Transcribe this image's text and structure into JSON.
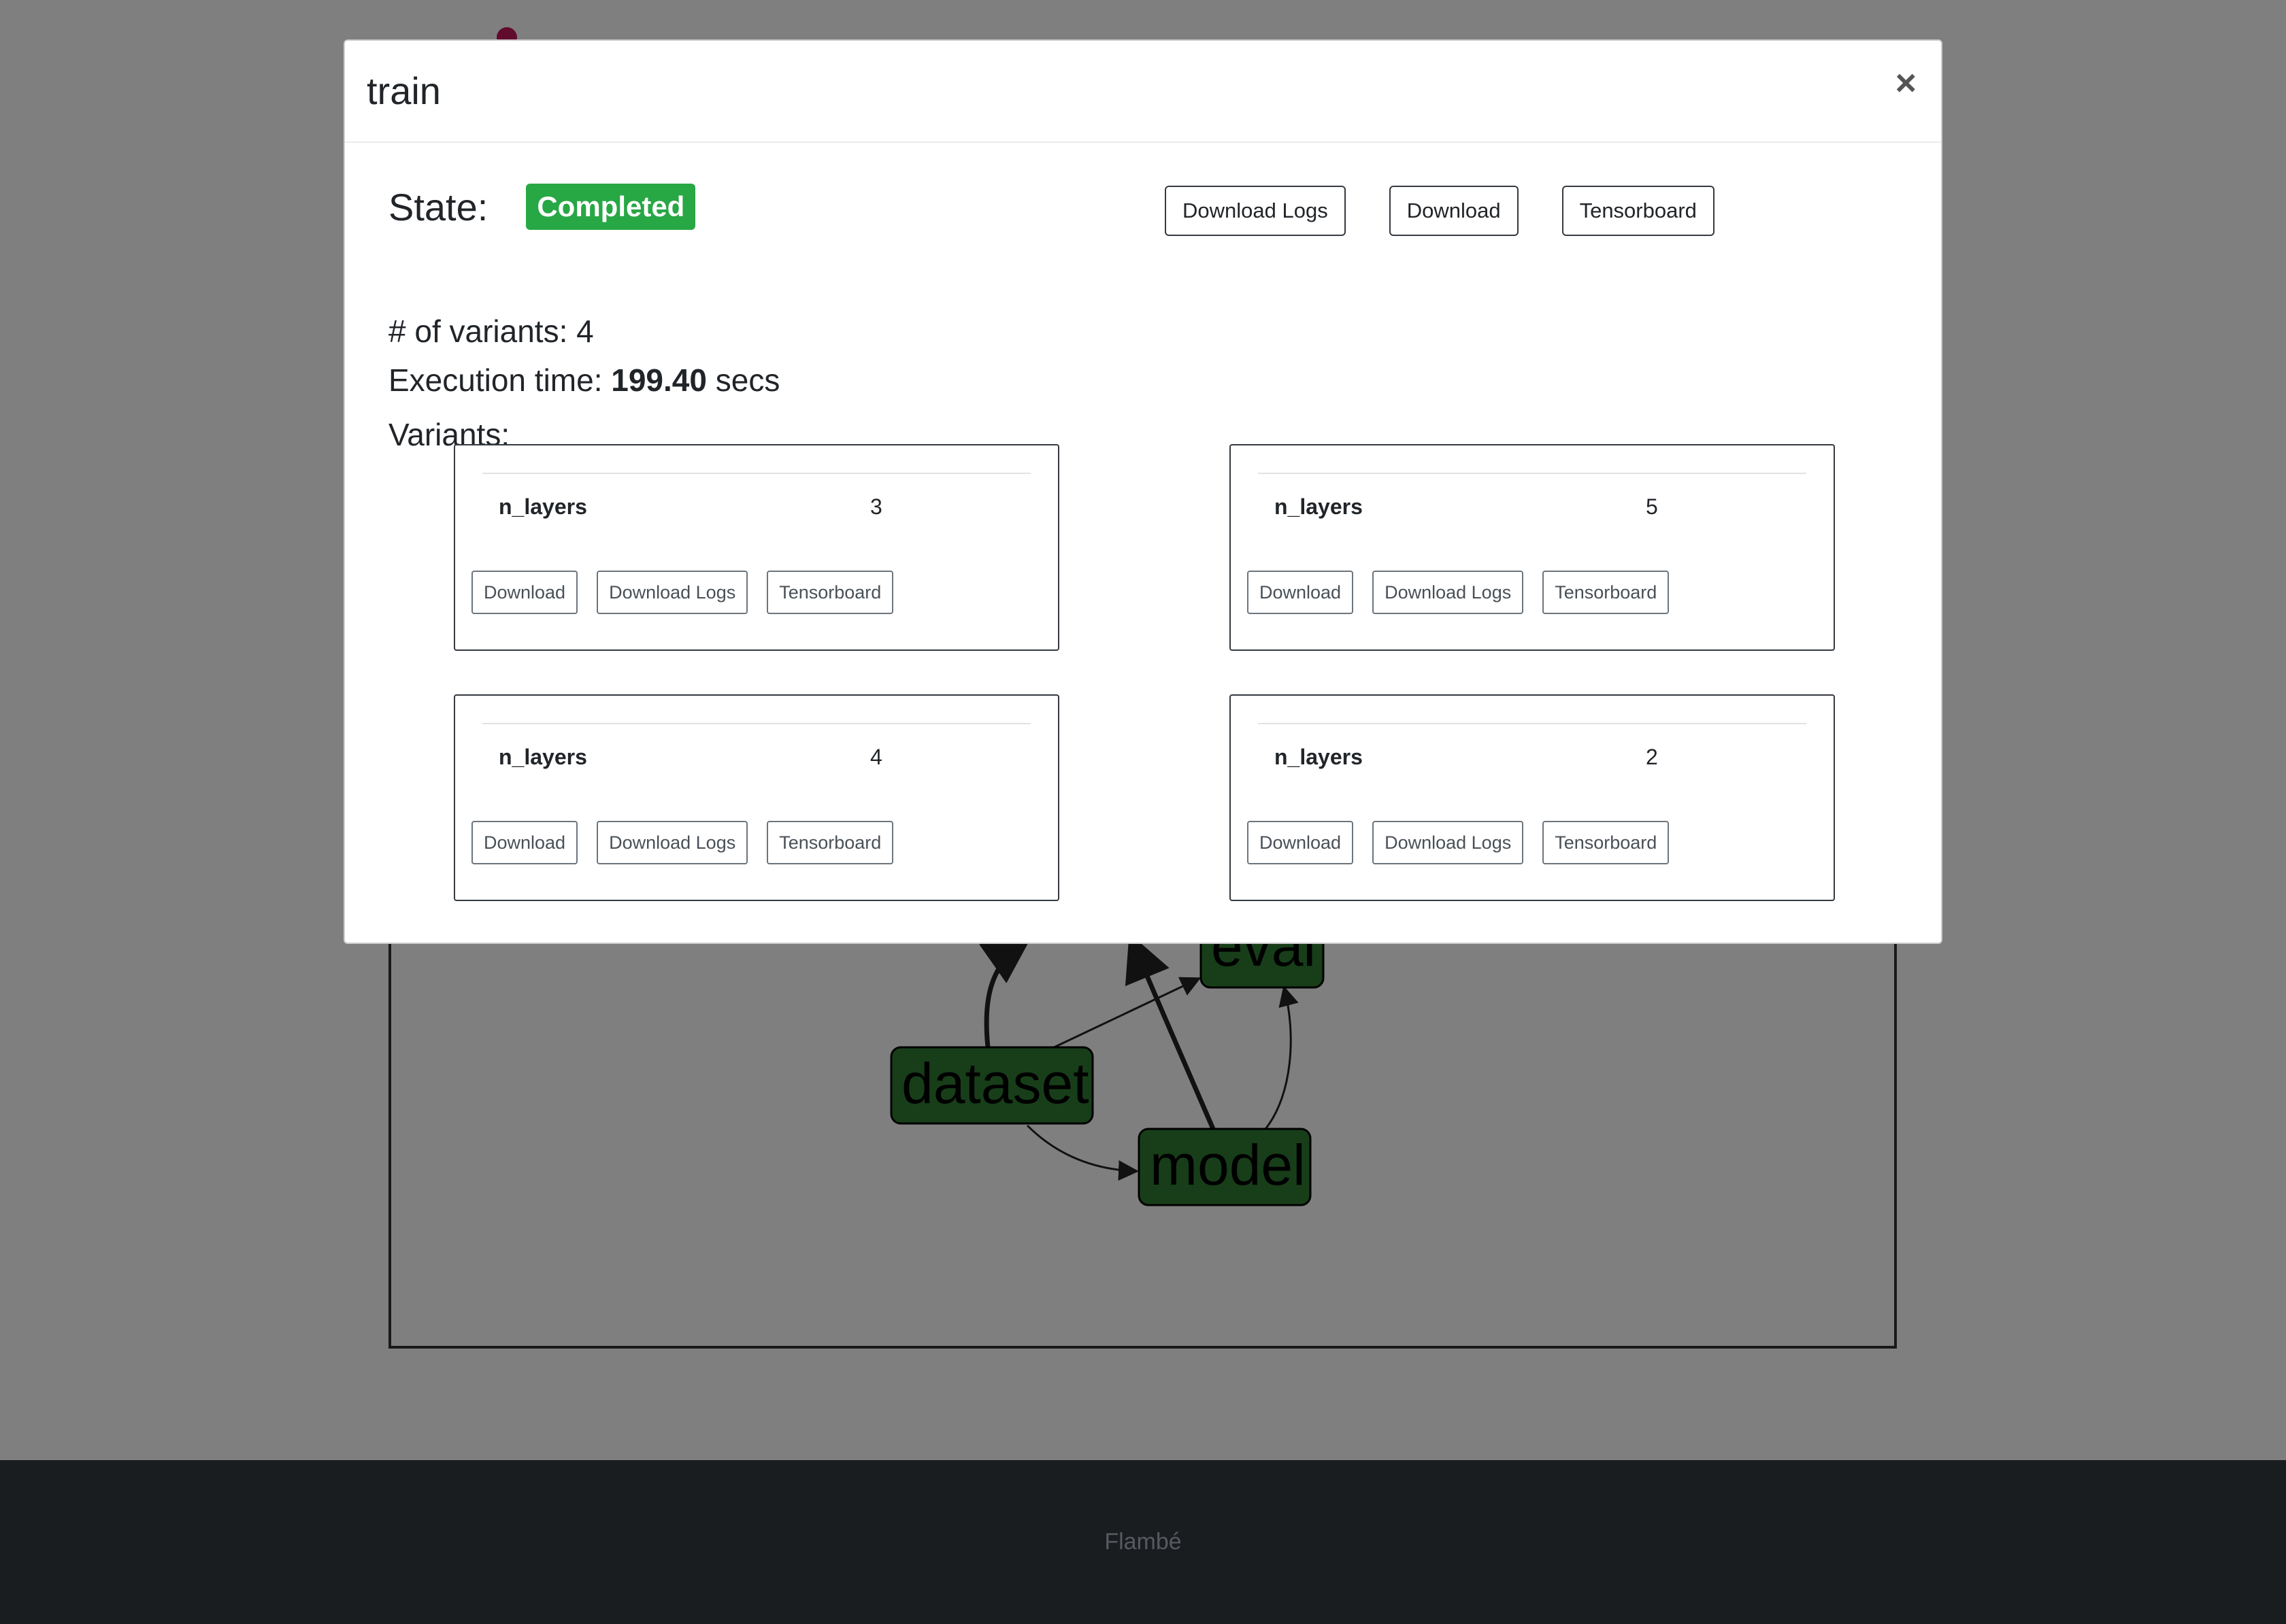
{
  "background": {
    "graph_nodes": [
      "eval",
      "dataset",
      "model"
    ],
    "footer_text": "Flambé"
  },
  "modal": {
    "title": "train",
    "close_label": "×",
    "state_label": "State:",
    "state_value": "Completed",
    "actions": [
      "Download Logs",
      "Download",
      "Tensorboard"
    ],
    "num_variants_text": "# of variants: 4",
    "exec_prefix": "Execution time: ",
    "exec_value": "199.40",
    "exec_suffix": " secs",
    "variants_label": "Variants:",
    "variants": [
      {
        "param": "n_layers",
        "value": "3",
        "buttons": [
          "Download",
          "Download Logs",
          "Tensorboard"
        ]
      },
      {
        "param": "n_layers",
        "value": "5",
        "buttons": [
          "Download",
          "Download Logs",
          "Tensorboard"
        ]
      },
      {
        "param": "n_layers",
        "value": "4",
        "buttons": [
          "Download",
          "Download Logs",
          "Tensorboard"
        ]
      },
      {
        "param": "n_layers",
        "value": "2",
        "buttons": [
          "Download",
          "Download Logs",
          "Tensorboard"
        ]
      }
    ]
  },
  "colors": {
    "success": "#28a745",
    "node_fill": "#2e7d32",
    "footer_bg": "#343a40",
    "brand_accent": "#c2185b"
  }
}
